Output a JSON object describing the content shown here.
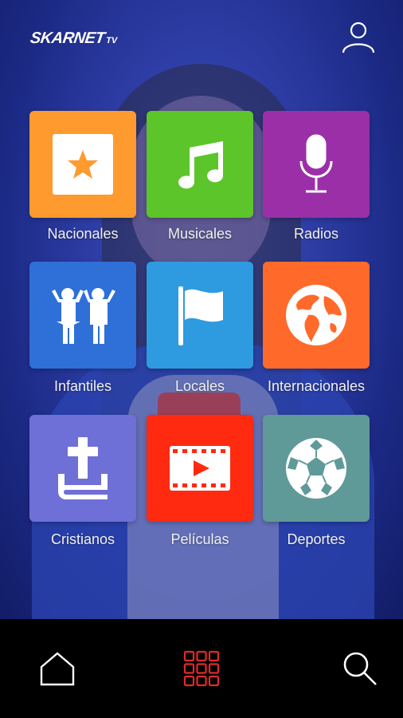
{
  "header": {
    "logo_text": "SKARNET",
    "logo_suffix": "TV",
    "profile_icon": "user-icon"
  },
  "categories": [
    {
      "label": "Nacionales",
      "icon": "star-icon",
      "color": "#ff9a2e"
    },
    {
      "label": "Musicales",
      "icon": "music-note-icon",
      "color": "#5bc52a"
    },
    {
      "label": "Radios",
      "icon": "microphone-icon",
      "color": "#9b2fa8"
    },
    {
      "label": "Infantiles",
      "icon": "children-icon",
      "color": "#2f6fd8"
    },
    {
      "label": "Locales",
      "icon": "flag-icon",
      "color": "#2e9be0"
    },
    {
      "label": "Internacionales",
      "icon": "globe-icon",
      "color": "#ff6a2a"
    },
    {
      "label": "Cristianos",
      "icon": "cross-bible-icon",
      "color": "#6f6fd8"
    },
    {
      "label": "Películas",
      "icon": "film-play-icon",
      "color": "#ff2a10"
    },
    {
      "label": "Deportes",
      "icon": "soccer-ball-icon",
      "color": "#5f9a98"
    }
  ],
  "bottom_nav": [
    {
      "icon": "home-icon",
      "active": false
    },
    {
      "icon": "grid-icon",
      "active": true,
      "active_color": "#e02a2a"
    },
    {
      "icon": "search-icon",
      "active": false
    }
  ]
}
